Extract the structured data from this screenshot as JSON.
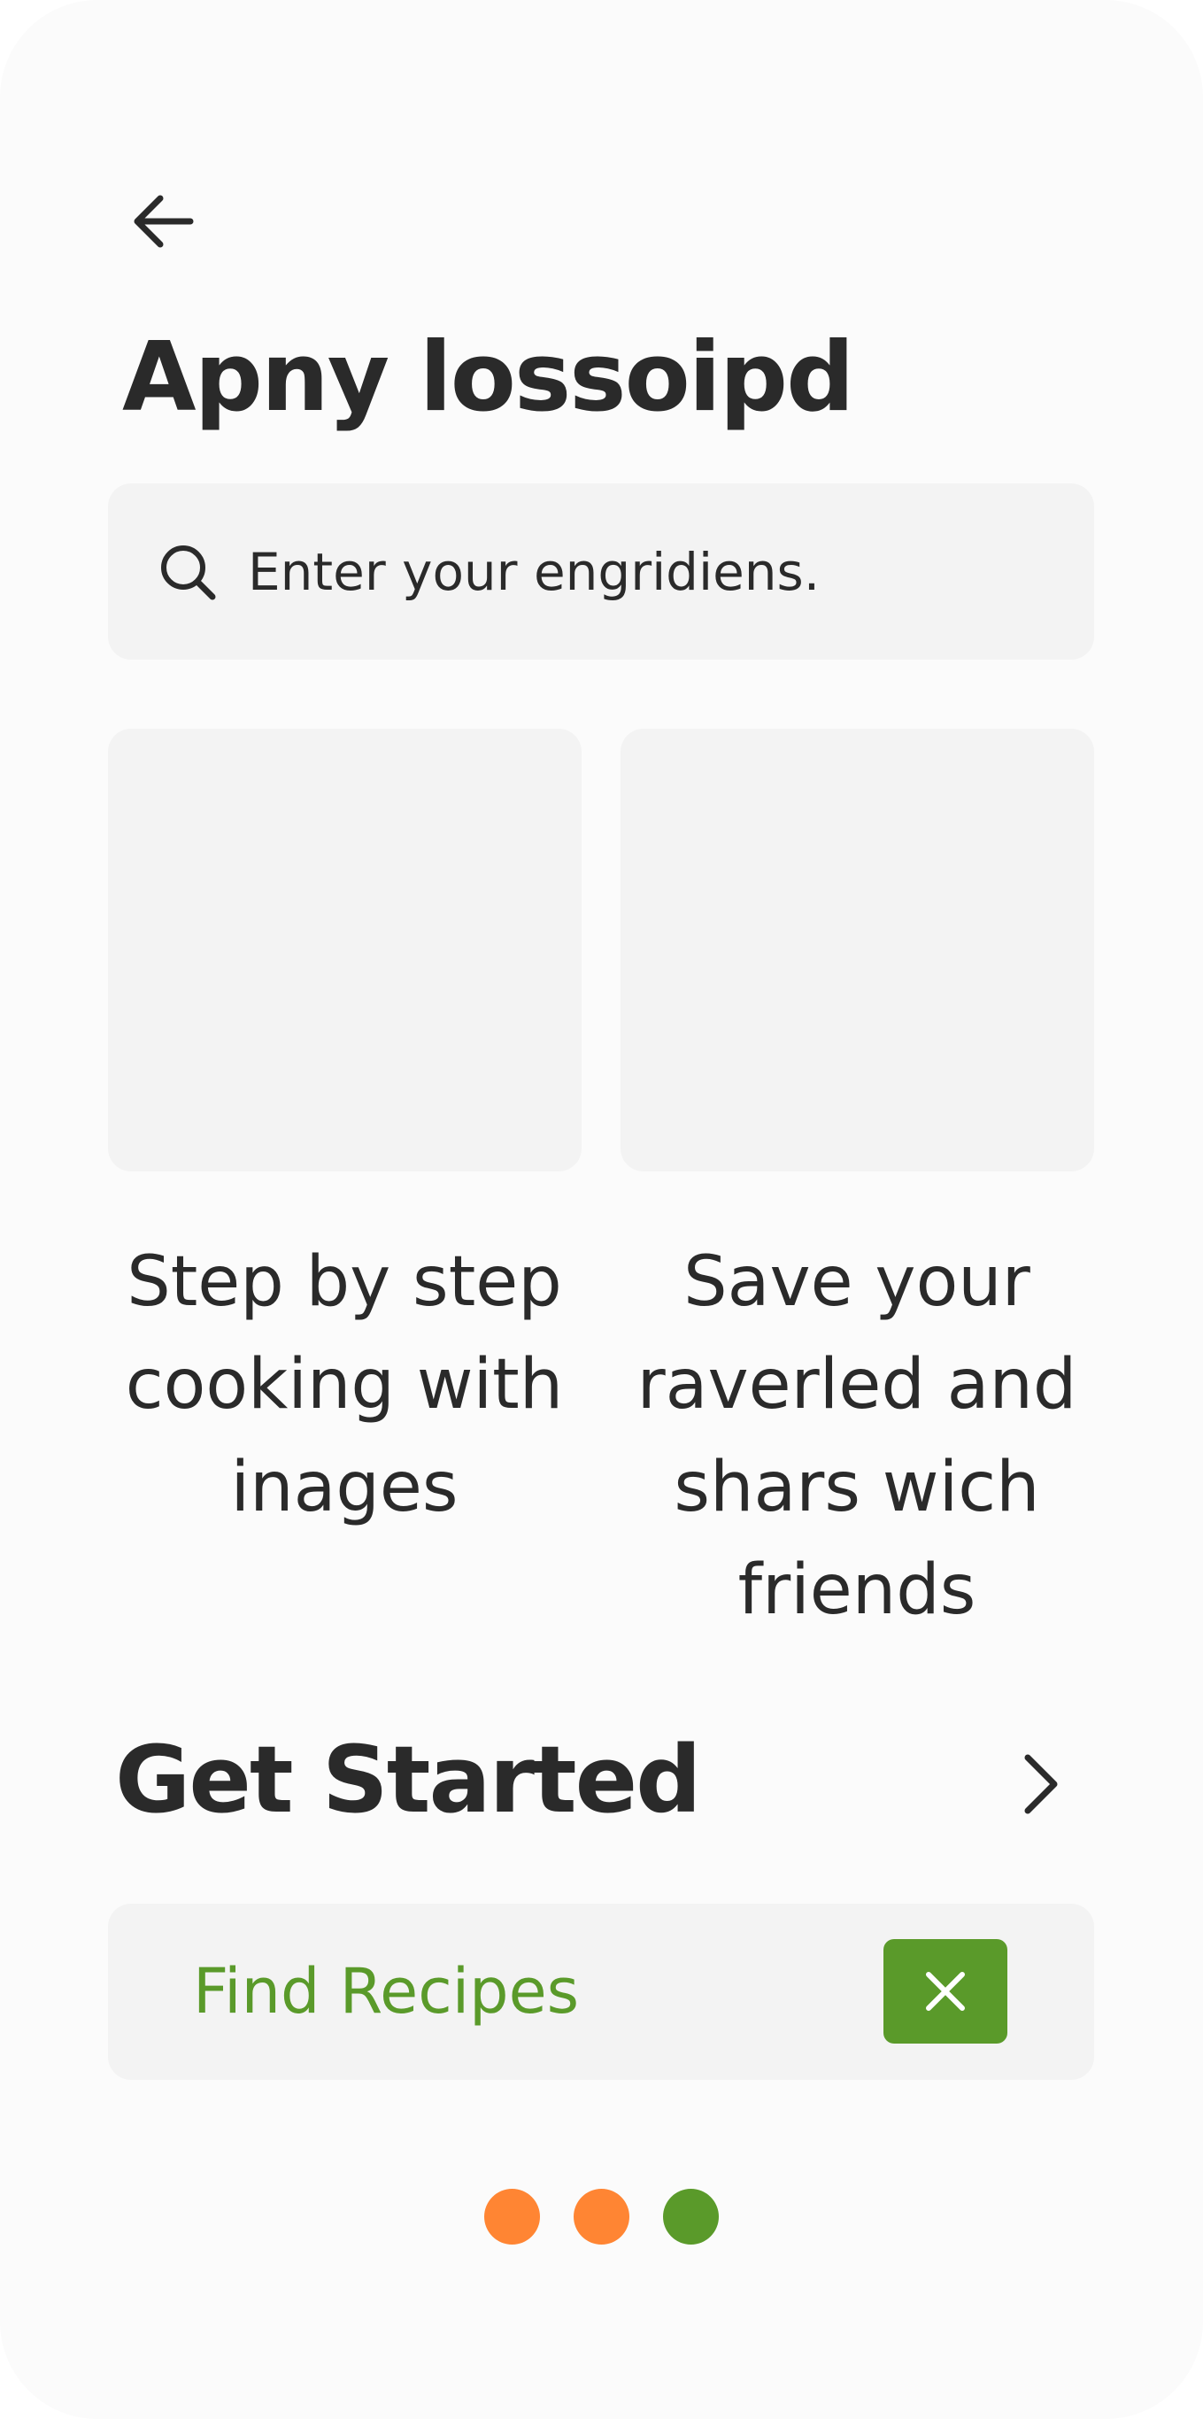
{
  "header": {
    "title": "Apny lossoipd"
  },
  "search": {
    "placeholder": "Enter your engridiens."
  },
  "features": [
    {
      "text": "Step by step cooking with inages"
    },
    {
      "text": "Save your raverled and shars wich friends"
    }
  ],
  "section": {
    "title": "Get Started"
  },
  "find_bar": {
    "label": "Find Recipes"
  },
  "icons": {
    "back": "arrow-left-icon",
    "search": "search-icon",
    "next": "chevron-right-icon",
    "close": "close-icon"
  },
  "pagination": {
    "dots": 3,
    "active_index": 2
  },
  "colors": {
    "accent_green": "#5a9a2a",
    "dot_orange": "#ff8533",
    "dot_green": "#5a9a2a",
    "surface": "#f3f3f3",
    "text": "#2a2a2a"
  }
}
